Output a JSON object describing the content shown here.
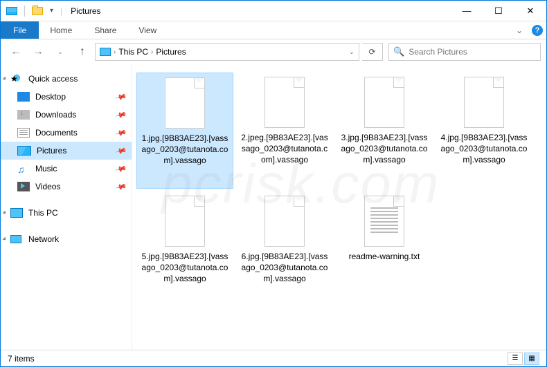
{
  "window": {
    "title": "Pictures"
  },
  "ribbon": {
    "file": "File",
    "tabs": [
      "Home",
      "Share",
      "View"
    ]
  },
  "breadcrumb": {
    "parts": [
      "This PC",
      "Pictures"
    ]
  },
  "search": {
    "placeholder": "Search Pictures"
  },
  "sidebar": {
    "quick_access": {
      "label": "Quick access"
    },
    "pinned": [
      {
        "label": "Desktop",
        "icon": "desktop"
      },
      {
        "label": "Downloads",
        "icon": "downloads"
      },
      {
        "label": "Documents",
        "icon": "docs"
      },
      {
        "label": "Pictures",
        "icon": "pics",
        "selected": true
      },
      {
        "label": "Music",
        "icon": "music"
      },
      {
        "label": "Videos",
        "icon": "videos"
      }
    ],
    "this_pc": {
      "label": "This PC"
    },
    "network": {
      "label": "Network"
    }
  },
  "files": [
    {
      "name": "1.jpg.[9B83AE23].[vassago_0203@tutanota.com].vassago",
      "selected": true,
      "type": "blank"
    },
    {
      "name": "2.jpeg.[9B83AE23].[vassago_0203@tutanota.com].vassago",
      "type": "blank"
    },
    {
      "name": "3.jpg.[9B83AE23].[vassago_0203@tutanota.com].vassago",
      "type": "blank"
    },
    {
      "name": "4.jpg.[9B83AE23].[vassago_0203@tutanota.com].vassago",
      "type": "blank"
    },
    {
      "name": "5.jpg.[9B83AE23].[vassago_0203@tutanota.com].vassago",
      "type": "blank"
    },
    {
      "name": "6.jpg.[9B83AE23].[vassago_0203@tutanota.com].vassago",
      "type": "blank"
    },
    {
      "name": "readme-warning.txt",
      "type": "txt"
    }
  ],
  "status": {
    "count": "7 items"
  }
}
